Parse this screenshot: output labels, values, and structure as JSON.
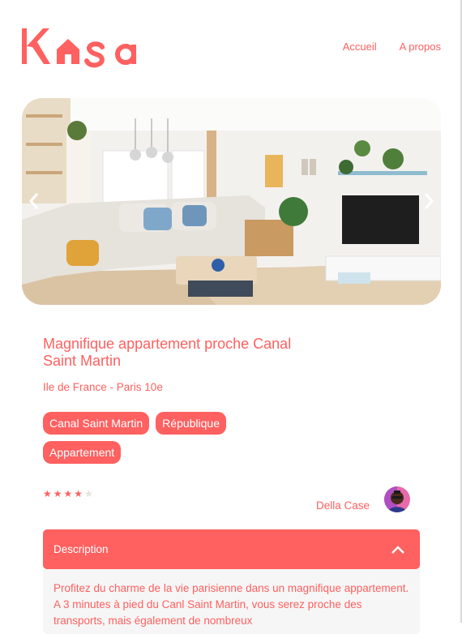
{
  "logo": {
    "text": "Kasa",
    "brand_color": "#FF6060"
  },
  "nav": {
    "home_label": "Accueil",
    "about_label": "A propos"
  },
  "carousel": {
    "prev_icon": "chevron-left-icon",
    "next_icon": "chevron-right-icon"
  },
  "listing": {
    "title": "Magnifique appartement proche Canal Saint Martin",
    "location": "Ile de France - Paris 10e",
    "tags": [
      "Canal Saint Martin",
      "République",
      "Appartement"
    ],
    "rating": 4,
    "rating_max": 5,
    "host_name": "Della Case"
  },
  "description": {
    "title": "Description",
    "toggle_icon": "chevron-up-icon",
    "text": "Profitez du charme de la vie parisienne dans un magnifique appartement. A 3 minutes à pied du Canl Saint Martin, vous serez proche des transports, mais également de nombreux"
  },
  "colors": {
    "accent": "#FF6060",
    "panel_bg": "#F6F6F6",
    "star_off": "#E3E3E3"
  }
}
